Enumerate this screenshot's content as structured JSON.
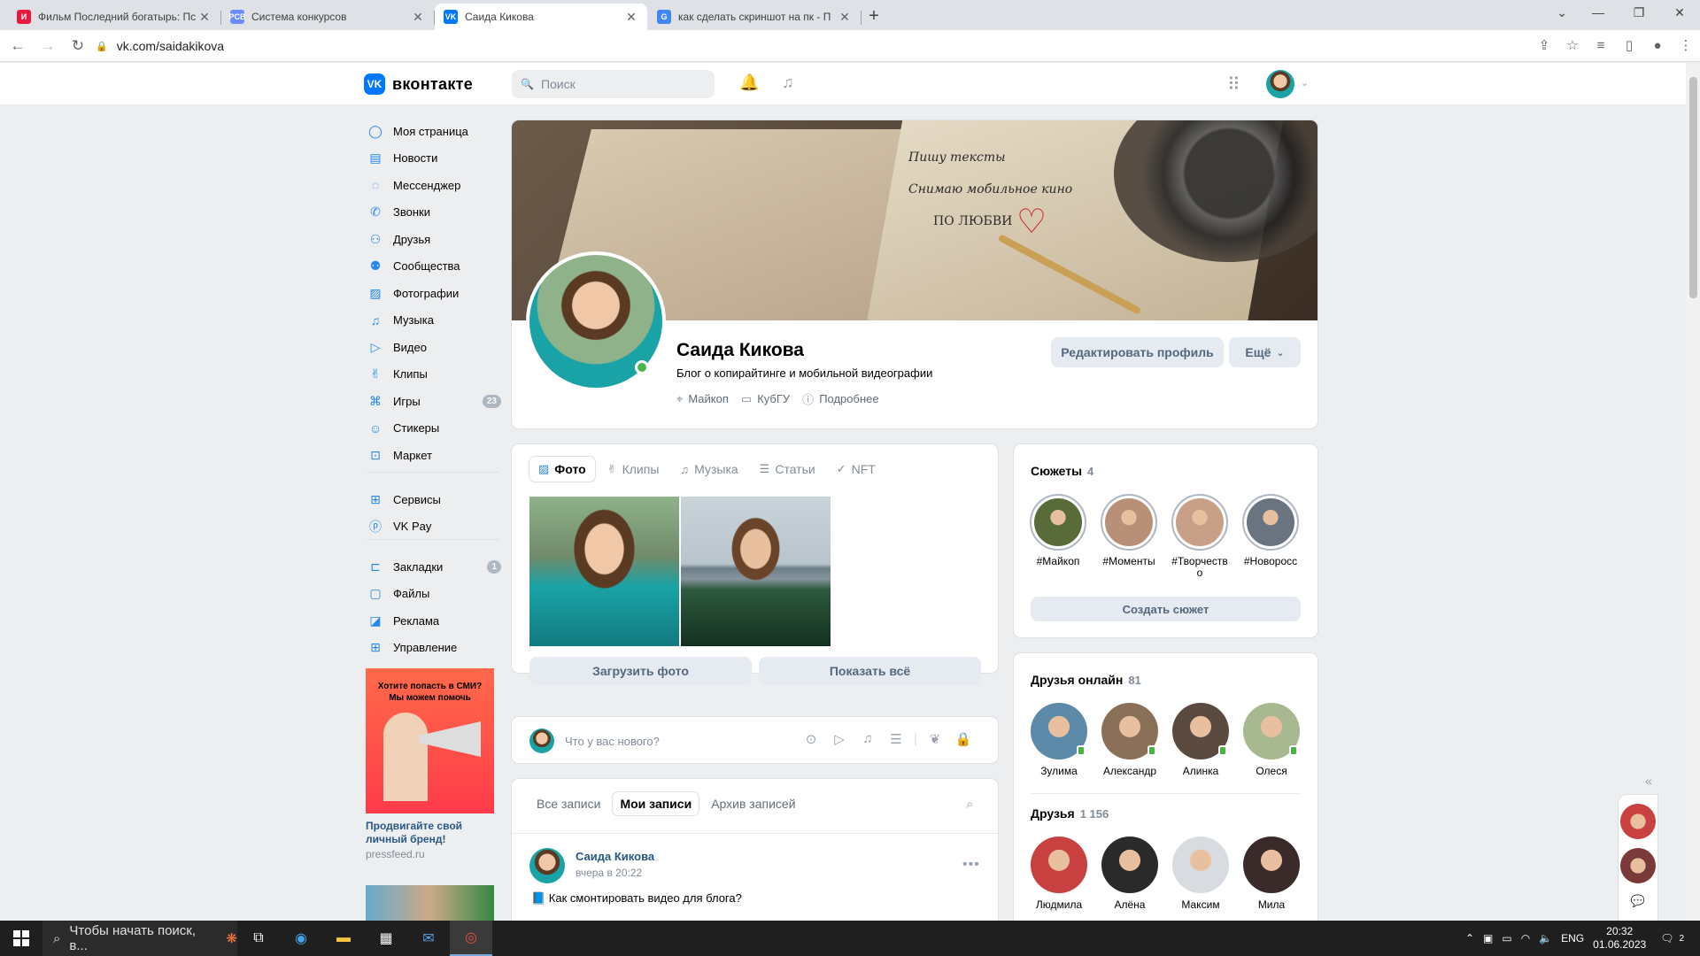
{
  "browser": {
    "tabs": [
      {
        "title": "Фильм Последний богатырь: Пс",
        "fav": "И",
        "color": "#e8193c",
        "active": false
      },
      {
        "title": "Система конкурсов",
        "fav": "PCB",
        "color": "#6b8cff",
        "active": false
      },
      {
        "title": "Саида Кикова",
        "fav": "VK",
        "color": "#0077ff",
        "active": true
      },
      {
        "title": "как сделать скриншот на пк - П",
        "fav": "G",
        "color": "#4285f4",
        "active": false
      }
    ],
    "new_tab": "+",
    "url": "vk.com/saidakikova"
  },
  "vk": {
    "logo_text": "вконтакте",
    "logo_mark": "VK",
    "search_placeholder": "Поиск",
    "menu": [
      {
        "label": "Моя страница",
        "icon": "user-icon"
      },
      {
        "label": "Новости",
        "icon": "news-icon"
      },
      {
        "label": "Мессенджер",
        "icon": "message-icon"
      },
      {
        "label": "Звонки",
        "icon": "phone-icon"
      },
      {
        "label": "Друзья",
        "icon": "friends-icon"
      },
      {
        "label": "Сообщества",
        "icon": "community-icon"
      },
      {
        "label": "Фотографии",
        "icon": "photo-icon"
      },
      {
        "label": "Музыка",
        "icon": "music-icon"
      },
      {
        "label": "Видео",
        "icon": "video-icon"
      },
      {
        "label": "Клипы",
        "icon": "clips-icon"
      },
      {
        "label": "Игры",
        "icon": "games-icon",
        "count": "23"
      },
      {
        "label": "Стикеры",
        "icon": "sticker-icon"
      },
      {
        "label": "Маркет",
        "icon": "market-icon"
      }
    ],
    "menu2": [
      {
        "label": "Сервисы",
        "icon": "services-icon"
      },
      {
        "label": "VK Pay",
        "icon": "vkpay-icon"
      }
    ],
    "menu3": [
      {
        "label": "Закладки",
        "icon": "bookmark-icon",
        "count": "1"
      },
      {
        "label": "Файлы",
        "icon": "files-icon"
      },
      {
        "label": "Реклама",
        "icon": "ads-icon"
      },
      {
        "label": "Управление",
        "icon": "manage-icon"
      }
    ],
    "ad": {
      "banner_text": "Хотите попасть в СМИ? Мы можем помочь",
      "title": "Продвигайте свой личный бренд!",
      "source": "pressfeed.ru"
    }
  },
  "cover": {
    "line1": "Пишу тексты",
    "line2": "Снимаю мобильное кино",
    "line3": "ПО ЛЮБВИ"
  },
  "profile": {
    "name": "Саида Кикова",
    "status": "Блог о копирайтинге и мобильной видеографии",
    "city": "Майкоп",
    "university": "КубГУ",
    "more": "Подробнее",
    "edit_button": "Редактировать профиль",
    "more_button": "Ещё"
  },
  "media_tabs": [
    {
      "label": "Фото",
      "icon": "photo-icon",
      "active": true
    },
    {
      "label": "Клипы",
      "icon": "clips-icon",
      "active": false
    },
    {
      "label": "Музыка",
      "icon": "music-icon",
      "active": false
    },
    {
      "label": "Статьи",
      "icon": "articles-icon",
      "active": false
    },
    {
      "label": "NFT",
      "icon": "nft-icon",
      "active": false
    }
  ],
  "photos_actions": {
    "upload": "Загрузить фото",
    "show_all": "Показать всё"
  },
  "composer": {
    "placeholder": "Что у вас нового?"
  },
  "wall_tabs": [
    {
      "label": "Все записи",
      "active": false
    },
    {
      "label": "Мои записи",
      "active": true
    },
    {
      "label": "Архив записей",
      "active": false
    }
  ],
  "post": {
    "author": "Саида Кикова",
    "time": "вчера в 20:22",
    "text": "📘 Как смонтировать видео для блога?"
  },
  "stories": {
    "title": "Сюжеты",
    "count": "4",
    "items": [
      {
        "label": "#Майкоп",
        "color": "#5a6b3a"
      },
      {
        "label": "#Моменты",
        "color": "#b89078"
      },
      {
        "label": "#Творчество",
        "color": "#c8a088"
      },
      {
        "label": "#Новоросс",
        "color": "#6a7480"
      }
    ],
    "create_button": "Создать сюжет"
  },
  "friends_online": {
    "title": "Друзья онлайн",
    "count": "81",
    "items": [
      {
        "name": "Зулима",
        "color": "#5c8aa8"
      },
      {
        "name": "Александр",
        "color": "#8a7058"
      },
      {
        "name": "Алинка",
        "color": "#5a4a40"
      },
      {
        "name": "Олеся",
        "color": "#a8b890"
      }
    ]
  },
  "friends": {
    "title": "Друзья",
    "count": "1 156",
    "items": [
      {
        "name": "Людмила",
        "color": "#c84040"
      },
      {
        "name": "Алёна",
        "color": "#2a2a2a"
      },
      {
        "name": "Максим",
        "color": "#d8dce0"
      },
      {
        "name": "Мила",
        "color": "#3a2a2a"
      }
    ]
  },
  "taskbar": {
    "search_placeholder": "Чтобы начать поиск, в...",
    "lang": "ENG",
    "time": "20:32",
    "date": "01.06.2023",
    "notif_count": "2"
  }
}
